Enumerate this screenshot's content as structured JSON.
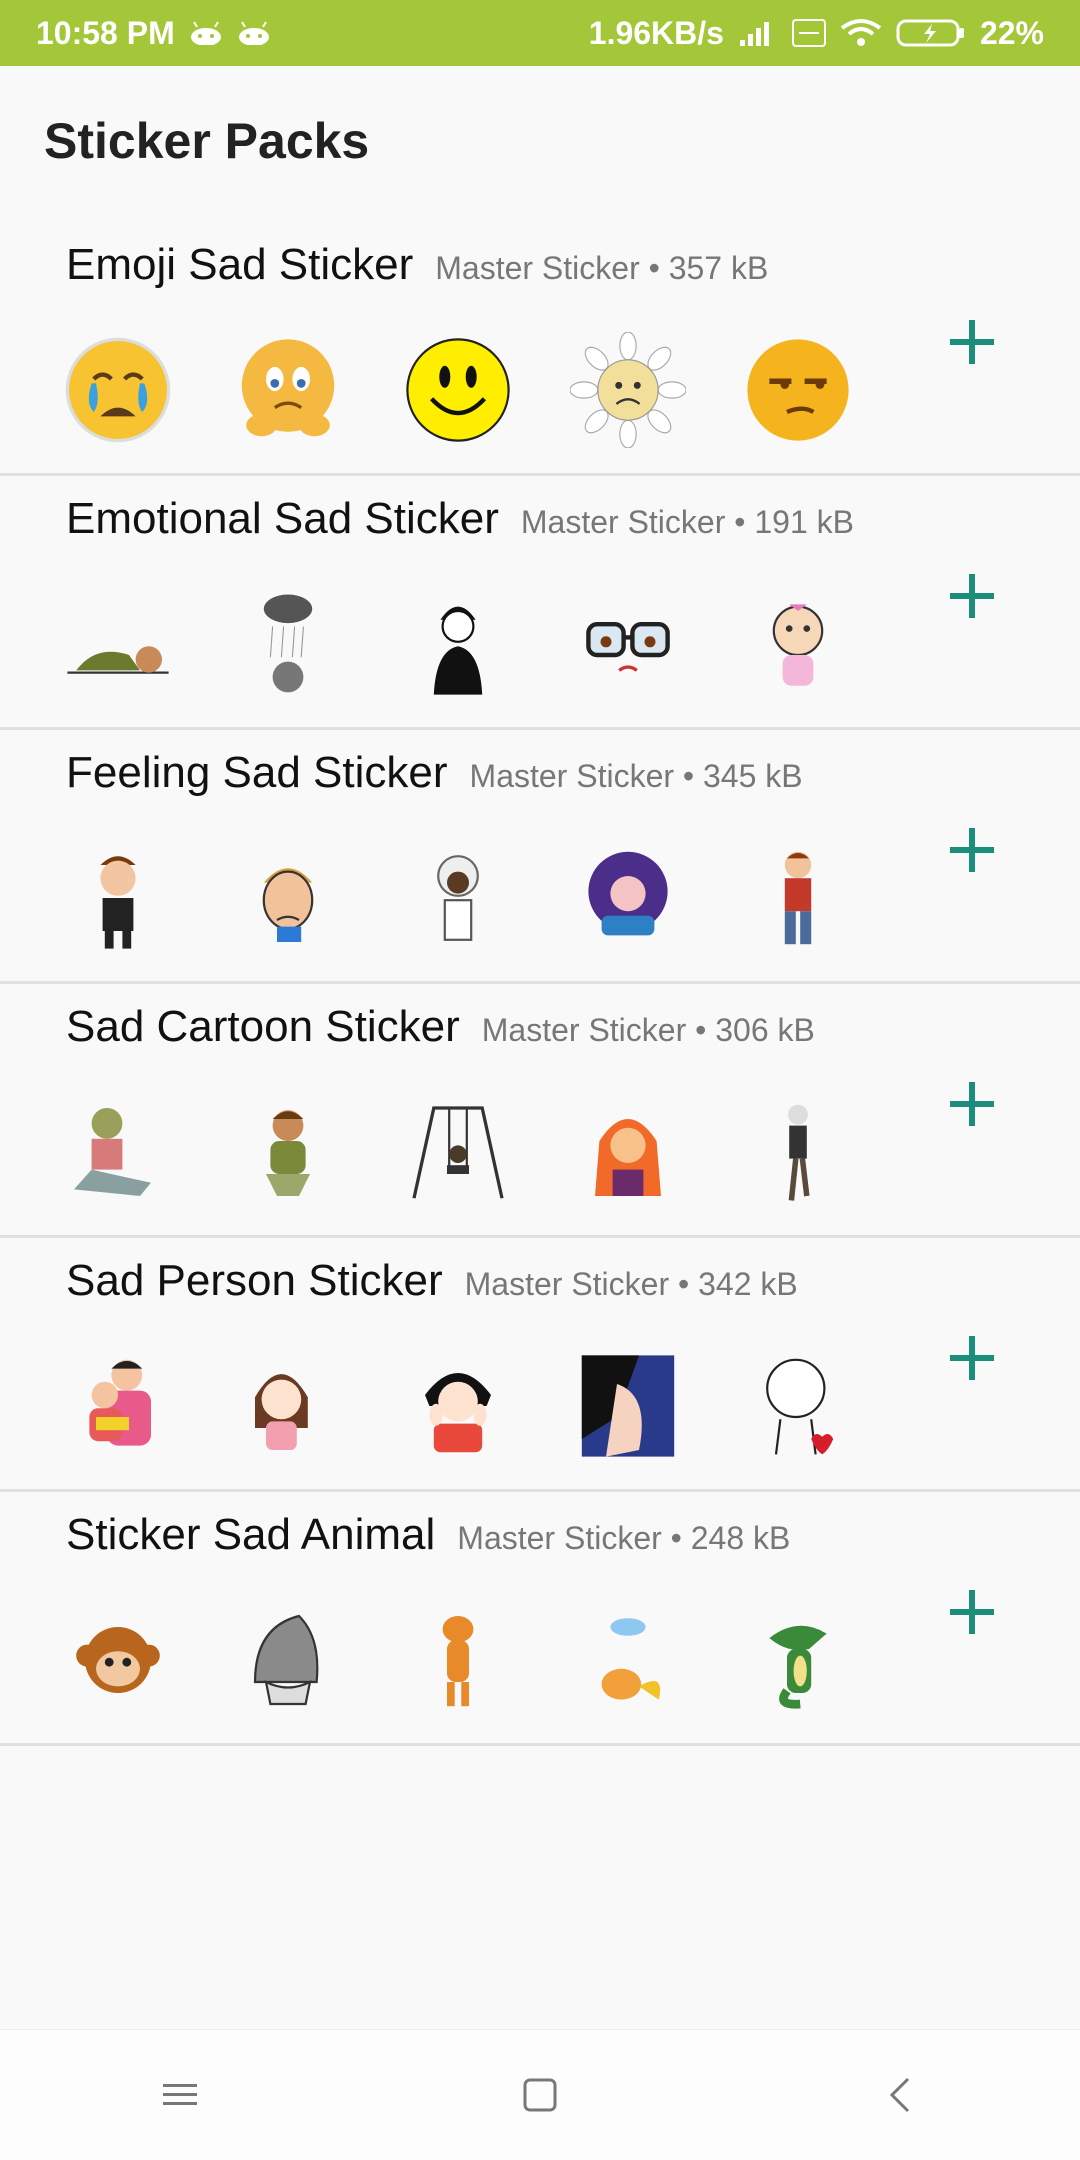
{
  "status_bar": {
    "time": "10:58 PM",
    "net_speed": "1.96KB/s",
    "battery": "22%"
  },
  "page": {
    "title": "Sticker Packs"
  },
  "packs": [
    {
      "name": "Emoji Sad Sticker",
      "meta": "Master Sticker • 357 kB",
      "thumbs": [
        "crying-emoji",
        "worried-emoji",
        "smiley-face",
        "sad-flower",
        "unamused-emoji"
      ]
    },
    {
      "name": "Emotional Sad Sticker",
      "meta": "Master Sticker • 191 kB",
      "thumbs": [
        "lying-man",
        "rain-cloud-cat",
        "sad-boy",
        "glasses-face",
        "crying-baby"
      ]
    },
    {
      "name": "Feeling Sad Sticker",
      "meta": "Master Sticker • 345 kB",
      "thumbs": [
        "crying-boy",
        "sad-man",
        "white-hair-person",
        "purple-lady",
        "boy-standing"
      ]
    },
    {
      "name": "Sad Cartoon Sticker",
      "meta": "Master Sticker • 306 kB",
      "thumbs": [
        "zombie-sitting",
        "boy-sitting",
        "swing-kid",
        "sad-girl",
        "person-climbing"
      ]
    },
    {
      "name": "Sad Person Sticker",
      "meta": "Master Sticker • 342 kB",
      "thumbs": [
        "hugging-couple",
        "sorry-girl",
        "worried-girl",
        "crying-woman",
        "broken-heart-stickman"
      ]
    },
    {
      "name": "Sticker Sad Animal",
      "meta": "Master Sticker • 248 kB",
      "thumbs": [
        "sad-monkey",
        "sad-shark",
        "sad-dog",
        "sad-fox",
        "sad-crocodile"
      ]
    }
  ],
  "colors": {
    "status_bar": "#a4c639",
    "accent": "#1a8e7a"
  }
}
